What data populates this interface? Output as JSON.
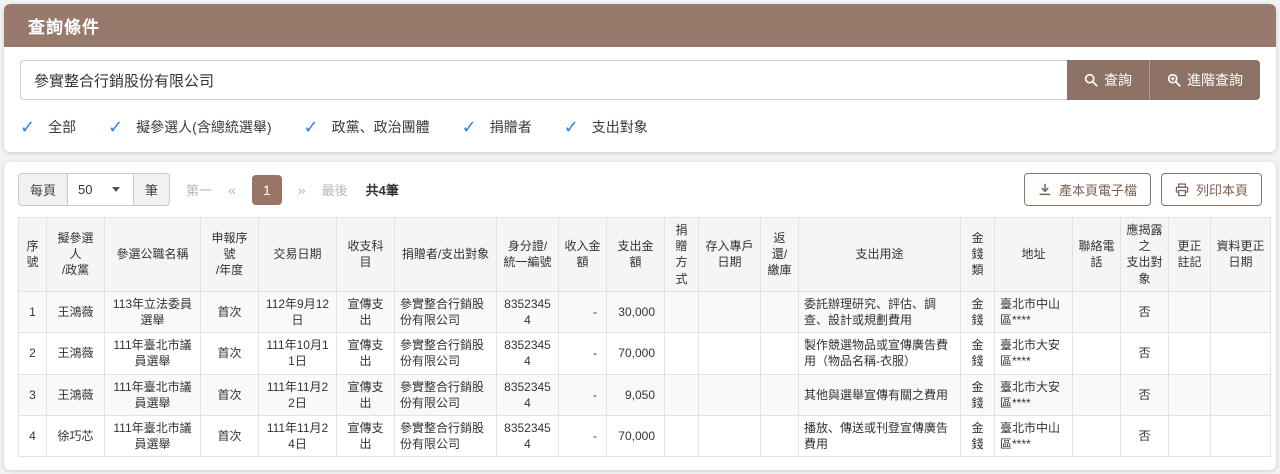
{
  "colors": {
    "header_brown": "#987a6d",
    "button_brown": "#8d7164",
    "active_page_brown": "#9a7565",
    "check_blue": "#3a7fd5"
  },
  "query_panel": {
    "title": "查詢條件",
    "search_value": "參實整合行銷股份有限公司",
    "search_button_label": "查詢",
    "advanced_button_label": "進階查詢",
    "filters": [
      {
        "label": "全部",
        "checked": true
      },
      {
        "label": "擬參選人(含總統選舉)",
        "checked": true
      },
      {
        "label": "政黨、政治團體",
        "checked": true
      },
      {
        "label": "捐贈者",
        "checked": true
      },
      {
        "label": "支出對象",
        "checked": true
      }
    ]
  },
  "toolbar": {
    "per_page_label": "每頁",
    "per_page_value": "50",
    "unit_label": "筆",
    "first_label": "第一",
    "prev_label": "«",
    "current_page": "1",
    "next_label": "»",
    "last_label": "最後",
    "total_label": "共4筆",
    "export_button_label": "產本頁電子檔",
    "print_button_label": "列印本頁"
  },
  "table": {
    "headers": [
      "序\n號",
      "擬參選人\n/政黨",
      "參選公職名稱",
      "申報序號\n/年度",
      "交易日期",
      "收支科目",
      "捐贈者/支出對象",
      "身分證/\n統一編號",
      "收入金額",
      "支出金額",
      "捐贈\n方式",
      "存入專戶日期",
      "返還/\n繳庫",
      "支出用途",
      "金錢\n類",
      "地址",
      "聯絡電話",
      "應揭露之\n支出對象",
      "更正註記",
      "資料更正日期"
    ],
    "rows": [
      [
        "1",
        "王鴻薇",
        "113年立法委員選舉",
        "首次",
        "112年9月12日",
        "宣傳支出",
        "參實整合行銷股份有限公司",
        "83523454",
        "-",
        "30,000",
        "",
        "",
        "",
        "委託辦理研究、評估、調查、設計或規劃費用",
        "金錢",
        "臺北市中山區****",
        "",
        "否",
        "",
        ""
      ],
      [
        "2",
        "王鴻薇",
        "111年臺北市議員選舉",
        "首次",
        "111年10月11日",
        "宣傳支出",
        "參實整合行銷股份有限公司",
        "83523454",
        "-",
        "70,000",
        "",
        "",
        "",
        "製作競選物品或宣傳廣告費用（物品名稱-衣服）",
        "金錢",
        "臺北市大安區****",
        "",
        "否",
        "",
        ""
      ],
      [
        "3",
        "王鴻薇",
        "111年臺北市議員選舉",
        "首次",
        "111年11月22日",
        "宣傳支出",
        "參實整合行銷股份有限公司",
        "83523454",
        "-",
        "9,050",
        "",
        "",
        "",
        "其他與選舉宣傳有關之費用",
        "金錢",
        "臺北市大安區****",
        "",
        "否",
        "",
        ""
      ],
      [
        "4",
        "徐巧芯",
        "111年臺北市議員選舉",
        "首次",
        "111年11月24日",
        "宣傳支出",
        "參實整合行銷股份有限公司",
        "83523454",
        "-",
        "70,000",
        "",
        "",
        "",
        "播放、傳送或刊登宣傳廣告費用",
        "金錢",
        "臺北市中山區****",
        "",
        "否",
        "",
        ""
      ]
    ]
  }
}
